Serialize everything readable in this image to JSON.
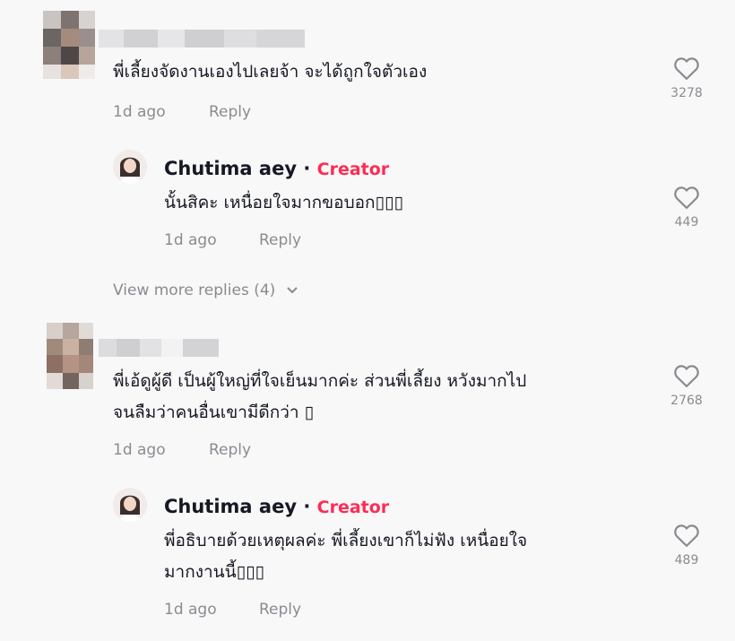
{
  "comments": [
    {
      "text": "พี่เลี้ยงจัดงานเองไปเลยจ้า จะได้ถูกใจตัวเอง",
      "time": "1d ago",
      "reply_label": "Reply",
      "likes": "3278",
      "reply": {
        "author": "Chutima aey",
        "separator": "·",
        "badge": "Creator",
        "text": "นั้นสิคะ เหนื่อยใจมากขอบอก▯▯▯",
        "time": "1d ago",
        "reply_label": "Reply",
        "likes": "449"
      },
      "view_more": "View more replies (4)"
    },
    {
      "text": "พี่เอ้ดูผู้ดี เป็นผู้ใหญ่ที่ใจเย็นมากค่ะ ส่วนพี่เลี้ยง หวังมากไป\nจนลืมว่าคนอื่นเขามีดีกว่า ▯",
      "time": "1d ago",
      "reply_label": "Reply",
      "likes": "2768",
      "reply": {
        "author": "Chutima aey",
        "separator": "·",
        "badge": "Creator",
        "text": "พี่อธิบายด้วยเหตุผลค่ะ พี่เลี้ยงเขาก็ไม่ฟัง เหนื่อยใจ\nมากงานนี้▯▯▯",
        "time": "1d ago",
        "reply_label": "Reply",
        "likes": "489"
      }
    }
  ],
  "colors": {
    "creator": "#fe2c55",
    "meta": "#8a8b91",
    "text": "#161823"
  },
  "icons": {
    "like": "heart-outline-icon",
    "expand": "chevron-down-icon"
  }
}
